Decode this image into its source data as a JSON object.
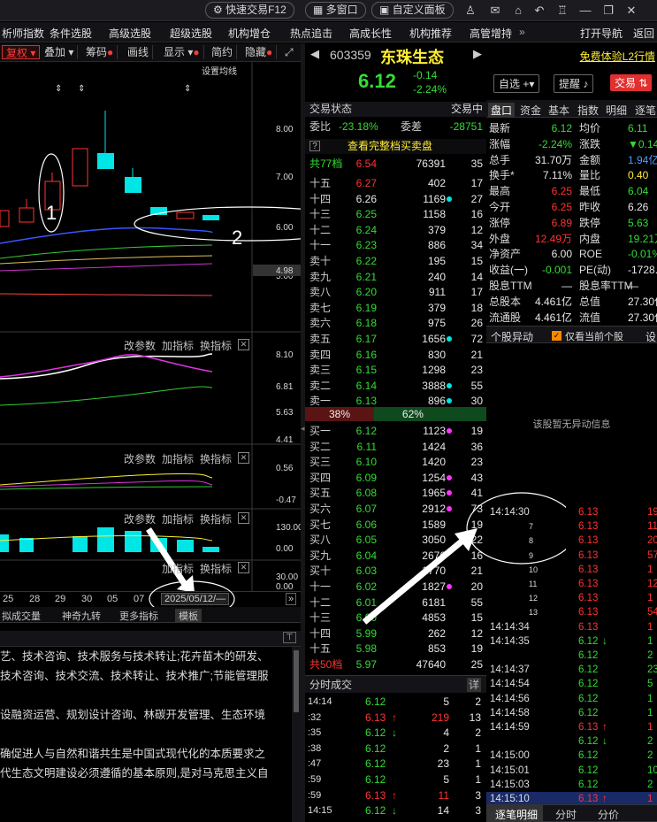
{
  "toolbar": {
    "quick_trade": "快速交易F12",
    "multi_window": "多窗口",
    "custom_panel": "自定义面板",
    "icons": [
      "user-icon",
      "mail-icon",
      "home-icon",
      "back-icon",
      "shirt-icon",
      "minimize-icon",
      "restore-icon",
      "close-icon"
    ]
  },
  "nav": {
    "items": [
      "析师指数",
      "条件选股",
      "高级选股",
      "超级选股",
      "机构增仓",
      "热点追击",
      "高成长性",
      "机构推荐",
      "高管增持"
    ],
    "more": "»",
    "right": [
      "打开导航",
      "返回"
    ]
  },
  "chart_toolbar": {
    "items": [
      "复权",
      "叠加",
      "筹码",
      "画线",
      "显示",
      "简约",
      "隐藏"
    ],
    "set_ma": "设置均线"
  },
  "kline": {
    "y_labels": [
      "8.00",
      "7.00",
      "6.00",
      "5.00",
      "4.98"
    ],
    "annotations": [
      "1",
      "2"
    ]
  },
  "subcharts": {
    "controls": [
      "改参数",
      "加指标",
      "换指标"
    ],
    "macd_labels": [
      "8.10",
      "6.81",
      "5.63",
      "4.41"
    ],
    "kdj_labels": [
      "0.56",
      "-0.47"
    ],
    "vol_labels": [
      "130.00",
      "0.00"
    ],
    "bottom_labels": [
      "30.00",
      "0.00"
    ]
  },
  "xaxis": {
    "labels": [
      "25",
      "28",
      "29",
      "30",
      "05",
      "07"
    ],
    "date_box": "2025/05/12/—"
  },
  "bottom_tabs": [
    "拟成交量",
    "神奇九转",
    "更多指标",
    "模板"
  ],
  "company_info": [
    "艺、技术咨询、技术服务与技术转让;花卉苗木的研发、",
    "技术咨询、技术交流、技术转让、技术推广;节能管理服",
    "",
    "设融资运营、规划设计咨询、林碳开发管理、生态环境",
    "",
    "确促进人与自然和谐共生是中国式现代化的本质要求之",
    "代生态文明建设必须遵循的基本原则,是对马克思主义自"
  ],
  "stock": {
    "code": "603359",
    "name": "东珠生态",
    "price": "6.12",
    "change": "-0.14",
    "change_pct": "-2.24%",
    "buttons": [
      "自选",
      "提醒",
      "交易"
    ],
    "l2_link": "免费体验L2行情"
  },
  "orderbook": {
    "title": "交易状态",
    "title_right": "交易中",
    "ratio_label": "委比",
    "ratio": "-23.18%",
    "diff_label": "委差",
    "diff": "-28751",
    "full_link": "查看完整档买卖盘",
    "sell_total_label": "共77档",
    "sell_total_price": "6.54",
    "sell_total_vol": "76391",
    "sell_total_cnt": "35",
    "sells": [
      {
        "label": "十五",
        "price": "6.27",
        "vol": "402",
        "cnt": "17"
      },
      {
        "label": "十四",
        "price": "6.26",
        "vol": "1169",
        "cnt": "27"
      },
      {
        "label": "十三",
        "price": "6.25",
        "vol": "1158",
        "cnt": "16"
      },
      {
        "label": "十二",
        "price": "6.24",
        "vol": "379",
        "cnt": "12"
      },
      {
        "label": "十一",
        "price": "6.23",
        "vol": "886",
        "cnt": "34"
      },
      {
        "label": "卖十",
        "price": "6.22",
        "vol": "195",
        "cnt": "15"
      },
      {
        "label": "卖九",
        "price": "6.21",
        "vol": "240",
        "cnt": "14"
      },
      {
        "label": "卖八",
        "price": "6.20",
        "vol": "911",
        "cnt": "17"
      },
      {
        "label": "卖七",
        "price": "6.19",
        "vol": "379",
        "cnt": "18"
      },
      {
        "label": "卖六",
        "price": "6.18",
        "vol": "975",
        "cnt": "26"
      },
      {
        "label": "卖五",
        "price": "6.17",
        "vol": "1656",
        "cnt": "72"
      },
      {
        "label": "卖四",
        "price": "6.16",
        "vol": "830",
        "cnt": "21"
      },
      {
        "label": "卖三",
        "price": "6.15",
        "vol": "1298",
        "cnt": "23"
      },
      {
        "label": "卖二",
        "price": "6.14",
        "vol": "3888",
        "cnt": "55"
      },
      {
        "label": "卖一",
        "price": "6.13",
        "vol": "896",
        "cnt": "30"
      }
    ],
    "bar_left": "38%",
    "bar_right": "62%",
    "bar_left_fraction": 0.38,
    "buys": [
      {
        "label": "买一",
        "price": "6.12",
        "vol": "1123",
        "cnt": "19"
      },
      {
        "label": "买二",
        "price": "6.11",
        "vol": "1424",
        "cnt": "36"
      },
      {
        "label": "买三",
        "price": "6.10",
        "vol": "1420",
        "cnt": "23"
      },
      {
        "label": "买四",
        "price": "6.09",
        "vol": "1254",
        "cnt": "43"
      },
      {
        "label": "买五",
        "price": "6.08",
        "vol": "1965",
        "cnt": "41"
      },
      {
        "label": "买六",
        "price": "6.07",
        "vol": "2912",
        "cnt": "73"
      },
      {
        "label": "买七",
        "price": "6.06",
        "vol": "1589",
        "cnt": "19"
      },
      {
        "label": "买八",
        "price": "6.05",
        "vol": "3050",
        "cnt": "22"
      },
      {
        "label": "买九",
        "price": "6.04",
        "vol": "2676",
        "cnt": "16"
      },
      {
        "label": "买十",
        "price": "6.03",
        "vol": "1770",
        "cnt": "21"
      },
      {
        "label": "十一",
        "price": "6.02",
        "vol": "1827",
        "cnt": "20"
      },
      {
        "label": "十二",
        "price": "6.01",
        "vol": "6181",
        "cnt": "55"
      },
      {
        "label": "十三",
        "price": "6.00",
        "vol": "4853",
        "cnt": "15"
      },
      {
        "label": "十四",
        "price": "5.99",
        "vol": "262",
        "cnt": "12"
      },
      {
        "label": "十五",
        "price": "5.98",
        "vol": "853",
        "cnt": "19"
      }
    ],
    "buy_total_label": "共50档",
    "buy_total_price": "5.97",
    "buy_total_vol": "47640",
    "buy_total_cnt": "25"
  },
  "time_sales": {
    "title": "分时成交",
    "detail": "详",
    "rows": [
      {
        "t": "14:14",
        "p": "6.12",
        "a": "",
        "v": "5",
        "n": "2"
      },
      {
        "t": ":32",
        "p": "6.13",
        "a": "↑",
        "v": "219",
        "n": "13"
      },
      {
        "t": ":35",
        "p": "6.12",
        "a": "↓",
        "v": "4",
        "n": "2"
      },
      {
        "t": ":38",
        "p": "6.12",
        "a": "",
        "v": "2",
        "n": "1"
      },
      {
        "t": ":47",
        "p": "6.12",
        "a": "",
        "v": "23",
        "n": "1"
      },
      {
        "t": ":59",
        "p": "6.12",
        "a": "",
        "v": "5",
        "n": "1"
      },
      {
        "t": ":59",
        "p": "6.13",
        "a": "↑",
        "v": "11",
        "n": "3"
      },
      {
        "t": "14:15",
        "p": "6.12",
        "a": "↓",
        "v": "14",
        "n": "3"
      }
    ]
  },
  "quote": {
    "tabs": [
      "盘口",
      "资金",
      "基本",
      "指数",
      "明细",
      "逐笔"
    ],
    "rows": [
      {
        "l1": "最新",
        "v1": "6.12",
        "l2": "均价",
        "v2": "6.11"
      },
      {
        "l1": "涨幅",
        "v1": "-2.24%",
        "l2": "涨跌",
        "v2": "▼0.14"
      },
      {
        "l1": "总手",
        "v1": "31.70万",
        "l2": "金额",
        "v2": "1.94亿"
      },
      {
        "l1": "换手*",
        "v1": "7.11%",
        "l2": "量比",
        "v2": "0.40"
      },
      {
        "l1": "最高",
        "v1": "6.25",
        "l2": "最低",
        "v2": "6.04"
      },
      {
        "l1": "今开",
        "v1": "6.25",
        "l2": "昨收",
        "v2": "6.26"
      },
      {
        "l1": "涨停",
        "v1": "6.89",
        "l2": "跌停",
        "v2": "5.63"
      },
      {
        "l1": "外盘",
        "v1": "12.49万",
        "l2": "内盘",
        "v2": "19.21万"
      },
      {
        "l1": "净资产",
        "v1": "6.00",
        "l2": "ROE",
        "v2": "-0.01%"
      },
      {
        "l1": "收益(一)",
        "v1": "-0.001",
        "l2": "PE(动)",
        "v2": "-1728.5"
      },
      {
        "l1": "股息TTM",
        "v1": "—",
        "l2": "股息率TTM",
        "v2": "—"
      },
      {
        "l1": "总股本",
        "v1": "4.461亿",
        "l2": "总值",
        "v2": "27.30亿"
      },
      {
        "l1": "流通股",
        "v1": "4.461亿",
        "l2": "流值",
        "v2": "27.30亿"
      }
    ],
    "alert_title": "个股异动",
    "alert_checkbox": "仅看当前个股",
    "alert_settings": "设",
    "alert_empty": "该股暂无异动信息"
  },
  "ticks": {
    "rows": [
      {
        "t": "14:14:30",
        "p": "6.13",
        "a": "",
        "v": "19"
      },
      {
        "t": "7",
        "p": "6.13",
        "a": "",
        "v": "11"
      },
      {
        "t": "8",
        "p": "6.13",
        "a": "",
        "v": "20"
      },
      {
        "t": "9",
        "p": "6.13",
        "a": "",
        "v": "57"
      },
      {
        "t": "10",
        "p": "6.13",
        "a": "",
        "v": "1"
      },
      {
        "t": "11",
        "p": "6.13",
        "a": "",
        "v": "12"
      },
      {
        "t": "12",
        "p": "6.13",
        "a": "",
        "v": "1"
      },
      {
        "t": "13",
        "p": "6.13",
        "a": "",
        "v": "54"
      },
      {
        "t": "14:14:34",
        "p": "6.13",
        "a": "",
        "v": "1"
      },
      {
        "t": "14:14:35",
        "p": "6.12",
        "a": "↓",
        "v": "1"
      },
      {
        "t": "",
        "p": "6.12",
        "a": "",
        "v": "2"
      },
      {
        "t": "14:14:37",
        "p": "6.12",
        "a": "",
        "v": "23"
      },
      {
        "t": "14:14:54",
        "p": "6.12",
        "a": "",
        "v": "5"
      },
      {
        "t": "14:14:56",
        "p": "6.12",
        "a": "",
        "v": "1"
      },
      {
        "t": "14:14:58",
        "p": "6.12",
        "a": "",
        "v": "1"
      },
      {
        "t": "14:14:59",
        "p": "6.13",
        "a": "↑",
        "v": "1"
      },
      {
        "t": "",
        "p": "6.12",
        "a": "↓",
        "v": "2"
      },
      {
        "t": "14:15:00",
        "p": "6.12",
        "a": "",
        "v": "2"
      },
      {
        "t": "14:15:01",
        "p": "6.12",
        "a": "",
        "v": "10"
      },
      {
        "t": "14:15:03",
        "p": "6.12",
        "a": "",
        "v": "2"
      },
      {
        "t": "14:15:10",
        "p": "6.13",
        "a": "↑",
        "v": "1"
      }
    ],
    "tabs": [
      "逐笔明细",
      "分时",
      "分价"
    ]
  }
}
